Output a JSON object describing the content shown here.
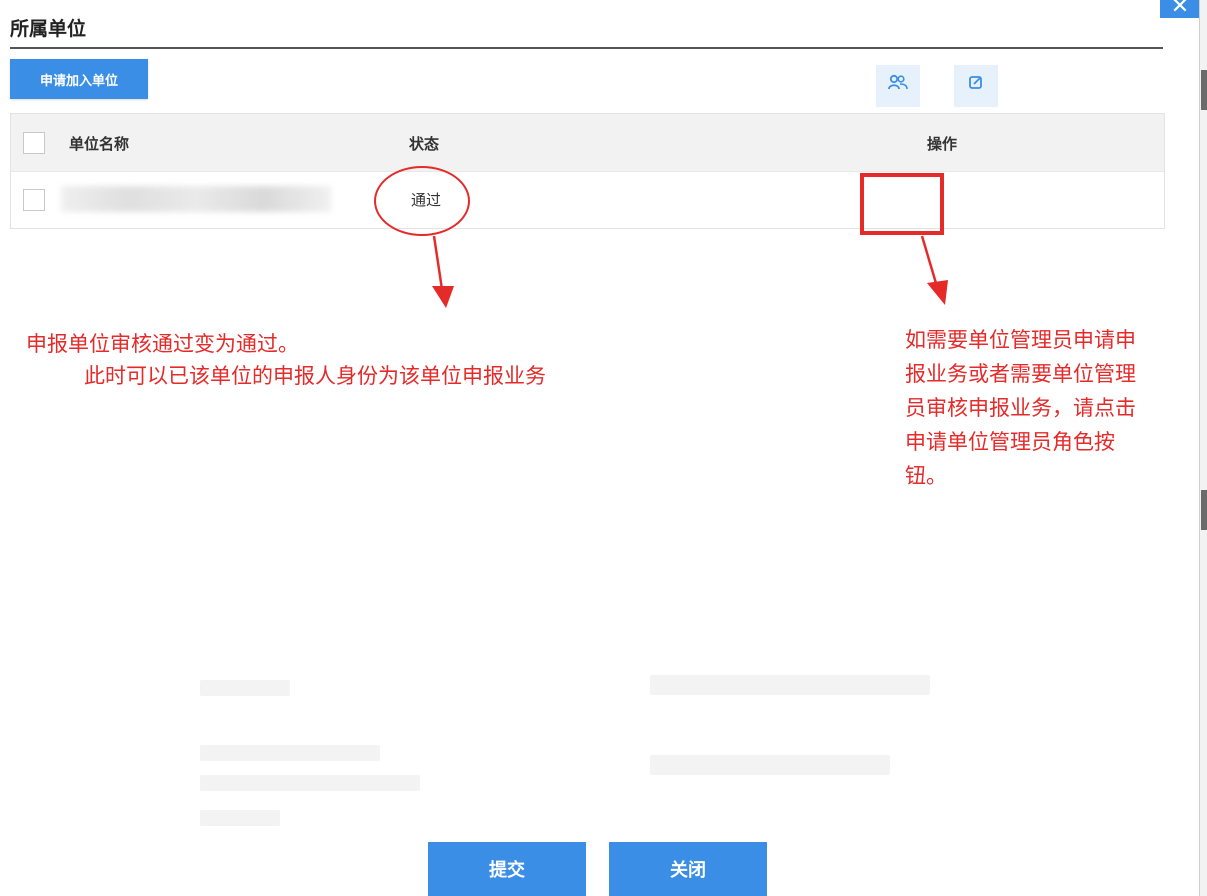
{
  "section_title": "所属单位",
  "toolbar": {
    "apply_label": "申请加入单位"
  },
  "table": {
    "headers": {
      "name": "单位名称",
      "status": "状态",
      "actions": "操作"
    },
    "rows": [
      {
        "name": "",
        "status": "通过"
      }
    ]
  },
  "annotations": {
    "left_line1": "申报单位审核通过变为通过。",
    "left_line2": "此时可以已该单位的申报人身份为该单位申报业务",
    "right_lines": [
      "如需要单位管理员申请申",
      "报业务或者需要单位管理",
      "员审核申报业务，请点击",
      "申请单位管理员角色按",
      "钮。"
    ]
  },
  "footer": {
    "submit_label": "提交",
    "close_label": "关闭"
  },
  "icons": {
    "close": "close-icon",
    "apply_admin_role": "users-icon",
    "edit": "edit-icon"
  },
  "colors": {
    "accent": "#3a8ee6",
    "annotation_red": "#e52a2a"
  }
}
